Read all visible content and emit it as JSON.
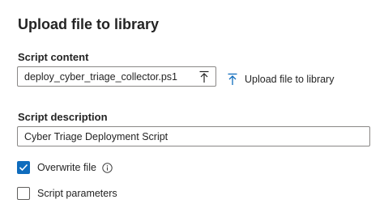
{
  "panel": {
    "title": "Upload file to library"
  },
  "script_content": {
    "label": "Script content",
    "file_value": "deploy_cyber_triage_collector.ps1",
    "upload_link_label": "Upload file to library"
  },
  "script_description": {
    "label": "Script description",
    "value": "Cyber Triage Deployment Script"
  },
  "options": {
    "overwrite": {
      "label": "Overwrite file",
      "checked": true
    },
    "parameters": {
      "label": "Script parameters",
      "checked": false
    }
  },
  "colors": {
    "accent": "#0f6cbd",
    "border": "#8a8886",
    "text": "#242424"
  },
  "icons": {
    "file_upload": "upload-arrow-icon",
    "link_upload": "upload-arrow-icon",
    "overwrite_info": "info-icon",
    "overwrite_check": "checkmark-icon"
  }
}
